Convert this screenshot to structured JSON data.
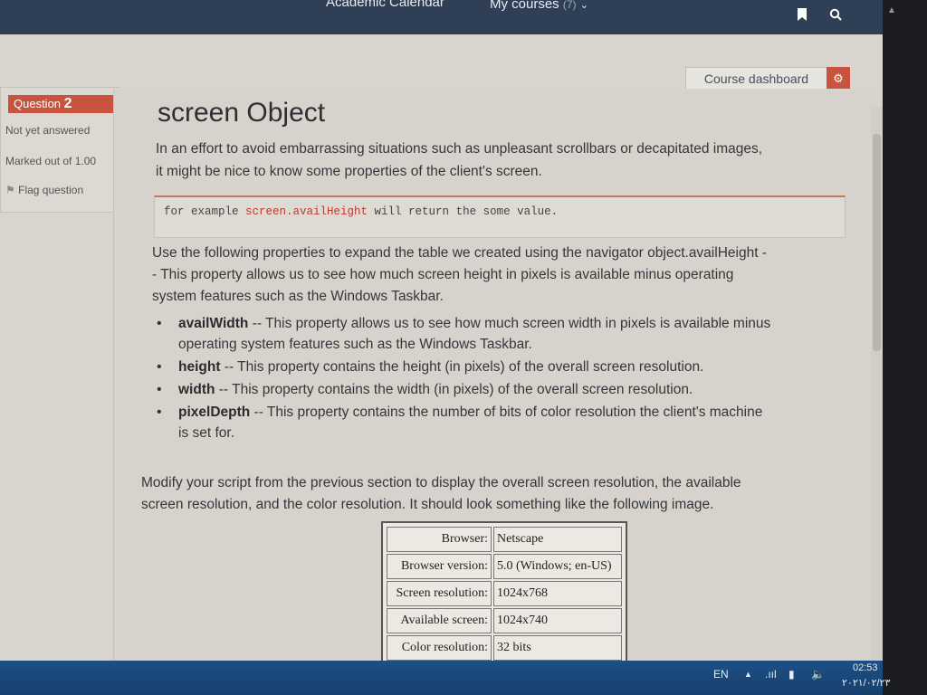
{
  "topbar": {
    "calendar_link": "Academic Calendar",
    "courses_link": "My courses",
    "courses_count": "(7)"
  },
  "course_dashboard": {
    "label": "Course dashboard"
  },
  "question_info": {
    "label": "Question",
    "number": "2",
    "status": "Not yet answered",
    "marks": "Marked out of 1.00",
    "flag": "Flag question"
  },
  "content": {
    "title": "screen Object",
    "intro_1": "In an effort to avoid embarrassing situations such as unpleasant scrollbars or decapitated images,",
    "intro_2": "it might be nice to know some properties of the client's screen.",
    "code_prefix": "for example ",
    "code_highlight": "screen.availHeight",
    "code_suffix": " will return the some value.",
    "use_1": "Use the following properties to expand the table we created using the navigator object.availHeight -",
    "use_2": "- This property allows us to see how much screen height in pixels is available minus operating",
    "use_3": "system features such as the Windows Taskbar.",
    "properties": [
      {
        "name": "availWidth",
        "desc_1": " -- This property allows us to see how much screen width in pixels is available minus",
        "desc_2": "operating system features such as the Windows Taskbar."
      },
      {
        "name": "height",
        "desc_1": " -- This property contains the height (in pixels) of the overall screen resolution.",
        "desc_2": ""
      },
      {
        "name": "width",
        "desc_1": " -- This property contains the width (in pixels) of the overall screen resolution.",
        "desc_2": ""
      },
      {
        "name": "pixelDepth",
        "desc_1": " -- This property contains the number of bits of color resolution the client's machine",
        "desc_2": "is set for."
      }
    ],
    "modify_1": "Modify your script from the previous section to display the overall screen resolution, the available",
    "modify_2": "screen resolution, and the color resolution. It should look something like the following image."
  },
  "sample_table": [
    {
      "key": "Browser:",
      "value": "Netscape"
    },
    {
      "key": "Browser version:",
      "value": "5.0 (Windows; en-US)"
    },
    {
      "key": "Screen resolution:",
      "value": "1024x768"
    },
    {
      "key": "Available screen:",
      "value": "1024x740"
    },
    {
      "key": "Color resolution:",
      "value": "32 bits"
    }
  ],
  "taskbar": {
    "language": "EN",
    "time": "02:53",
    "date": "٢٠٢١/٠٢/٢٣"
  },
  "icons": {
    "bookmark": "bookmark-icon",
    "search": "search-icon",
    "gear": "gear-icon",
    "flag": "flag-icon"
  },
  "colors": {
    "accent": "#c8533e",
    "topbar": "#2f3f55",
    "taskbar": "#1d4f86"
  }
}
